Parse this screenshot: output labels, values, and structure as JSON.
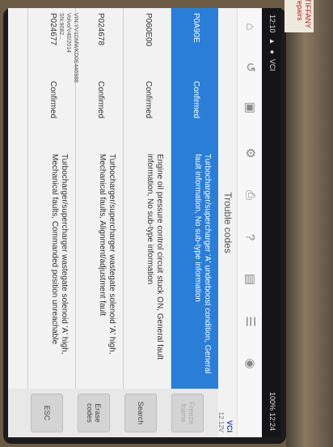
{
  "app": {
    "title": "Trouble codes",
    "brand_badge": "VCI",
    "battery_voltage": "12.12V",
    "status_left_time": "12:10",
    "status_right": "100% 12:24"
  },
  "toolbar": {
    "icons": [
      "home-icon",
      "back-icon",
      "car-icon",
      "settings-icon",
      "print-icon",
      "help-icon",
      "report-icon",
      "history-icon",
      "record-icon"
    ]
  },
  "codes": [
    {
      "code": "P0A90E",
      "status": "Confirmed",
      "description": "Turbocharger/supercharger 'A' underboost condition, General fault information, No sub-type information"
    },
    {
      "code": "P060E00",
      "status": "Confirmed",
      "description": "Engine oil pressure control circuit stuck ON, General fault information, No sub-type information"
    },
    {
      "code": "P024678",
      "status": "Confirmed",
      "description": "Turbocharger/supercharger wastegate solenoid 'A' high, Mechanical faults, Alignment/adjustment fault"
    },
    {
      "code": "P024677",
      "status": "Confirmed",
      "description": "Turbocharger/supercharger wastegate solenoid 'A' high, Mechanical faults, Commanded position unreachable"
    }
  ],
  "buttons": {
    "freeze_frame": "Freeze frame",
    "search": "Search",
    "erase_codes": "Erase codes",
    "esc": "ESC"
  },
  "vehicle": {
    "line1": "VIN:YV1DMWKD0E446988",
    "line2": "Volvo/V40/2014",
    "line3": "SN:9082..."
  },
  "sticker_text": "TIFFANY repairs"
}
